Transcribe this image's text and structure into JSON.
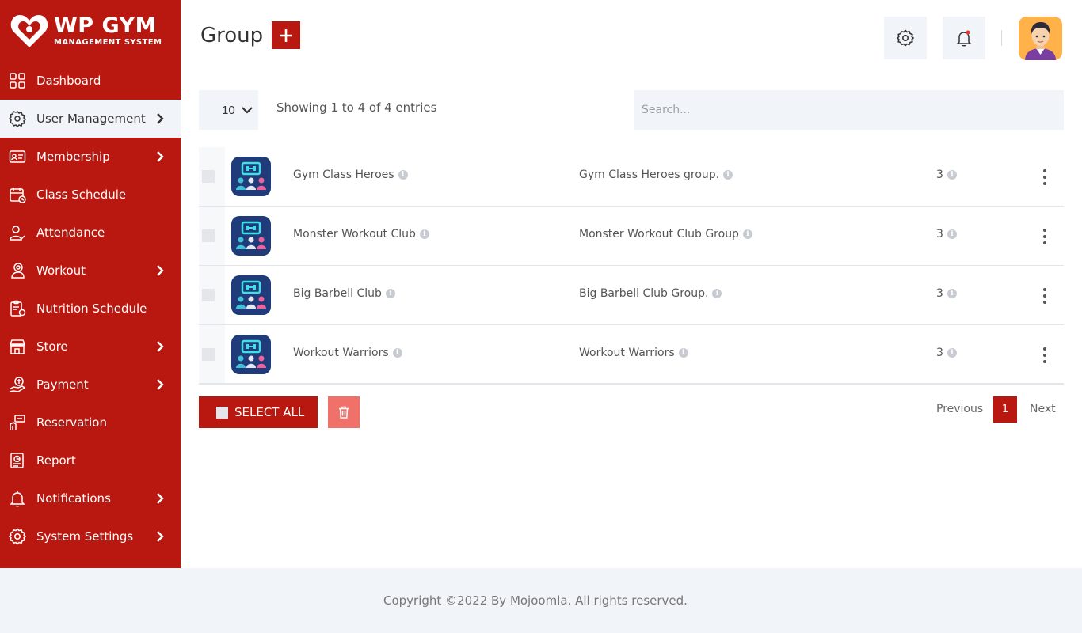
{
  "brand": {
    "title": "WP GYM",
    "subtitle": "MANAGEMENT SYSTEM"
  },
  "sidebar": {
    "items": [
      {
        "label": "Dashboard",
        "icon": "dashboard-icon",
        "chevron": false,
        "active": false
      },
      {
        "label": "User Management",
        "icon": "users-gear-icon",
        "chevron": true,
        "active": true
      },
      {
        "label": "Membership",
        "icon": "membership-card-icon",
        "chevron": true,
        "active": false
      },
      {
        "label": "Class Schedule",
        "icon": "calendar-icon",
        "chevron": false,
        "active": false
      },
      {
        "label": "Attendance",
        "icon": "user-check-icon",
        "chevron": false,
        "active": false
      },
      {
        "label": "Workout",
        "icon": "workout-icon",
        "chevron": true,
        "active": false
      },
      {
        "label": "Nutrition Schedule",
        "icon": "nutrition-icon",
        "chevron": false,
        "active": false
      },
      {
        "label": "Store",
        "icon": "store-icon",
        "chevron": true,
        "active": false
      },
      {
        "label": "Payment",
        "icon": "payment-icon",
        "chevron": true,
        "active": false
      },
      {
        "label": "Reservation",
        "icon": "reservation-icon",
        "chevron": false,
        "active": false
      },
      {
        "label": "Report",
        "icon": "report-icon",
        "chevron": false,
        "active": false
      },
      {
        "label": "Notifications",
        "icon": "bell-icon",
        "chevron": true,
        "active": false
      },
      {
        "label": "System Settings",
        "icon": "gear-icon",
        "chevron": true,
        "active": false
      }
    ]
  },
  "header": {
    "title": "Group"
  },
  "controls": {
    "entries": "10",
    "showing": "Showing 1 to 4 of 4 entries",
    "search_placeholder": "Search..."
  },
  "table": {
    "rows": [
      {
        "name": "Gym Class Heroes",
        "description": "Gym Class Heroes group.",
        "count": "3"
      },
      {
        "name": "Monster Workout Club",
        "description": "Monster Workout Club Group",
        "count": "3"
      },
      {
        "name": "Big Barbell Club",
        "description": "Big Barbell Club Group.",
        "count": "3"
      },
      {
        "name": "Workout Warriors",
        "description": "Workout Warriors",
        "count": "3"
      }
    ]
  },
  "actions": {
    "select_all": "SELECT ALL"
  },
  "pagination": {
    "previous": "Previous",
    "current": "1",
    "next": "Next"
  },
  "footer": {
    "copyright": "Copyright ©2022 By Mojoomla. All rights reserved."
  },
  "colors": {
    "primary": "#b8180f",
    "panel": "#f1f4f9",
    "delete": "#f0706a",
    "avatar_bg": "#ffb14a"
  }
}
